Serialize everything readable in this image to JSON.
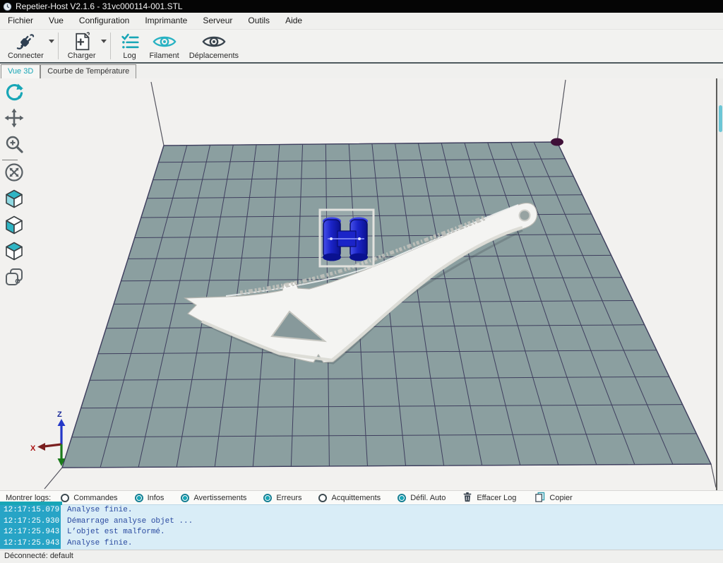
{
  "window": {
    "title": "Repetier-Host V2.1.6 - 31vc000114-001.STL"
  },
  "menu": {
    "items": [
      "Fichier",
      "Vue",
      "Configuration",
      "Imprimante",
      "Serveur",
      "Outils",
      "Aide"
    ]
  },
  "toolbar": {
    "buttons": [
      {
        "label": "Connecter",
        "icon": "plug-icon",
        "dropdown": true,
        "group_end": true
      },
      {
        "label": "Charger",
        "icon": "add-document-icon",
        "dropdown": true,
        "group_end": true
      },
      {
        "label": "Log",
        "icon": "checklist-icon",
        "dropdown": false,
        "group_end": false
      },
      {
        "label": "Filament",
        "icon": "filament-eye-icon",
        "dropdown": false,
        "group_end": false
      },
      {
        "label": "Déplacements",
        "icon": "movements-eye-icon",
        "dropdown": false,
        "group_end": false
      }
    ]
  },
  "tabs": [
    {
      "label": "Vue 3D",
      "active": true
    },
    {
      "label": "Courbe de Température",
      "active": false
    }
  ],
  "view_tools": [
    {
      "name": "rotate-view-tool",
      "icon": "rotate-icon",
      "active": true,
      "separator_before": false
    },
    {
      "name": "move-view-tool",
      "icon": "move-icon",
      "active": false,
      "separator_before": false
    },
    {
      "name": "zoom-view-tool",
      "icon": "zoom-icon",
      "active": false,
      "separator_before": false
    },
    {
      "name": "fit-view-tool",
      "icon": "fit-view-icon",
      "active": false,
      "separator_before": true
    },
    {
      "name": "isometric-view-tool",
      "icon": "cube-iso-icon",
      "active": false,
      "separator_before": false
    },
    {
      "name": "front-view-tool",
      "icon": "cube-front-icon",
      "active": false,
      "separator_before": false
    },
    {
      "name": "top-view-tool",
      "icon": "cube-top-icon",
      "active": false,
      "separator_before": false
    },
    {
      "name": "show-objects-tool",
      "icon": "objects-icon",
      "active": false,
      "separator_before": false
    }
  ],
  "viewport": {
    "axis": {
      "x": "X",
      "z": "Z"
    }
  },
  "log_toolbar": {
    "label": "Montrer logs:",
    "toggles": [
      {
        "label": "Commandes",
        "checked": false
      },
      {
        "label": "Infos",
        "checked": true
      },
      {
        "label": "Avertissements",
        "checked": true
      },
      {
        "label": "Erreurs",
        "checked": true
      },
      {
        "label": "Acquittements",
        "checked": false
      },
      {
        "label": "Défil. Auto",
        "checked": true
      }
    ],
    "actions": [
      {
        "label": "Effacer Log",
        "icon": "trash-icon"
      },
      {
        "label": "Copier",
        "icon": "copy-icon"
      }
    ]
  },
  "log": {
    "entries": [
      {
        "time": "12:17:15.079",
        "message": "Analyse finie."
      },
      {
        "time": "12:17:25.930",
        "message": "Démarrage analyse objet ..."
      },
      {
        "time": "12:17:25.943",
        "message": "L’objet est malformé."
      },
      {
        "time": "12:17:25.943",
        "message": "Analyse finie."
      }
    ]
  },
  "status_bar": {
    "text": "Déconnecté: default"
  },
  "colors": {
    "accent_teal": "#18a6b6",
    "titlebar_bg": "#050505",
    "viewport_bg": "#f2f1ef",
    "bed_fill": "#8b9fa0",
    "bed_grid": "#3f3f5e",
    "origin_marker": "#3f1038",
    "model_color": "#f4f4f2",
    "object_blue": "#1b24c8",
    "log_time_bg": "#27a4c6",
    "log_bg": "#d9edf7",
    "log_text": "#2a4aa0",
    "axis_x": "#aa1111",
    "axis_y": "#1b7a1b",
    "axis_z": "#2438c8"
  }
}
